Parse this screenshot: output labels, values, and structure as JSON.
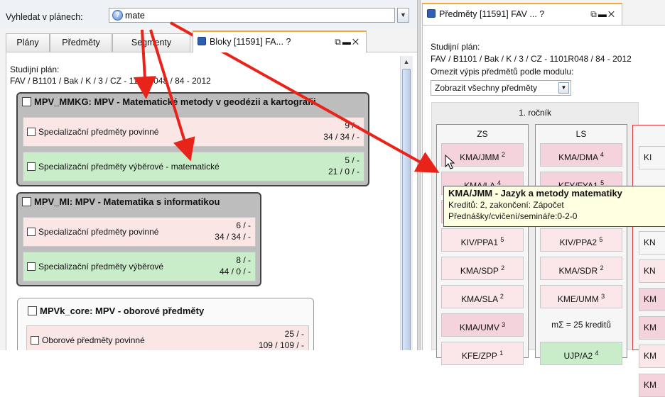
{
  "search": {
    "label": "Vyhledat v plánech:",
    "value": "mate",
    "help_icon": "?"
  },
  "left_tabs": [
    {
      "label": "Plány"
    },
    {
      "label": "Předměty"
    },
    {
      "label": "Segmenty"
    },
    {
      "label": "Bloky  [11591] FA...  ?"
    }
  ],
  "left": {
    "plan_label": "Studijní plán:",
    "plan_value": "FAV / B1101 / Bak / K / 3 / CZ - 1101R048 / 84 - 2012",
    "modules": [
      {
        "title": "MPV_MMKG: MPV - Matematické metody v geodézii a kartografii",
        "blocks": [
          {
            "name": "Specializační předměty povinné",
            "line1": "9 / -",
            "line2": "34 / 34 / -"
          },
          {
            "name": "Specializační předměty výběrové - matematické",
            "line1": "5 / -",
            "line2": "21 / 0 / -"
          }
        ]
      },
      {
        "title": "MPV_MI: MPV - Matematika s informatikou",
        "blocks": [
          {
            "name": "Specializační předměty povinné",
            "line1": "6 / -",
            "line2": "34 / 34 / -"
          },
          {
            "name": "Specializační předměty výběrové",
            "line1": "8 / -",
            "line2": "44 / 0 / -"
          }
        ]
      },
      {
        "title": "MPVk_core: MPV - oborové předměty",
        "blocks": [
          {
            "name": "Oborové předměty povinné",
            "line1": "25 / -",
            "line2": "109 / 109 / -"
          }
        ]
      }
    ]
  },
  "right": {
    "tab_label": "Předměty  [11591] FAV ...  ?",
    "plan_label": "Studijní plán:",
    "plan_value": "FAV / B1101 / Bak / K / 3 / CZ - 1101R048 / 84 - 2012",
    "filter_label": "Omezit výpis předmětů podle modulu:",
    "filter_value": "Zobrazit všechny předměty",
    "year_label": "1. ročník",
    "semesters": [
      {
        "label": "ZS",
        "courses": [
          {
            "code": "KMA/JMM",
            "credits": "2",
            "style": "pink"
          },
          {
            "code": "KMA/LA",
            "credits": "4",
            "style": "pink"
          },
          {
            "code": "",
            "credits": "",
            "style": "pink"
          },
          {
            "code": "KIV/PPA1",
            "credits": "5",
            "style": "lpink"
          },
          {
            "code": "KMA/SDP",
            "credits": "2",
            "style": "lpink"
          },
          {
            "code": "KMA/SLA",
            "credits": "2",
            "style": "lpink"
          },
          {
            "code": "KMA/UMV",
            "credits": "3",
            "style": "pink"
          },
          {
            "code": "KFE/ZPP",
            "credits": "1",
            "style": "lpink"
          }
        ]
      },
      {
        "label": "LS",
        "courses": [
          {
            "code": "KMA/DMA",
            "credits": "4",
            "style": "pink"
          },
          {
            "code": "KFY/FYA1",
            "credits": "5",
            "style": "pink"
          },
          {
            "code": "",
            "credits": "",
            "style": "pink"
          },
          {
            "code": "KIV/PPA2",
            "credits": "5",
            "style": "lpink"
          },
          {
            "code": "KMA/SDR",
            "credits": "2",
            "style": "lpink"
          },
          {
            "code": "KME/UMM",
            "credits": "3",
            "style": "lpink"
          },
          {
            "code": "mΣ = 25 kreditů",
            "credits": "",
            "style": "plain"
          },
          {
            "code": "UJP/A2",
            "credits": "4",
            "style": "green"
          }
        ]
      }
    ],
    "second_column": [
      "KI",
      "KN",
      "KN",
      "KM",
      "KM",
      "KM",
      "KM"
    ],
    "tooltip": {
      "title": "KMA/JMM - Jazyk a metody matematiky",
      "line1": "Kreditů: 2, zakončení: Zápočet",
      "line2": "Přednášky/cvičení/semináře:0-2-0"
    }
  },
  "colors": {
    "annotation_arrow": "#e8231a",
    "active_tab_accent": "#f2a93b",
    "pink_block": "#fbe6e6",
    "green_block": "#c9ecc9"
  }
}
